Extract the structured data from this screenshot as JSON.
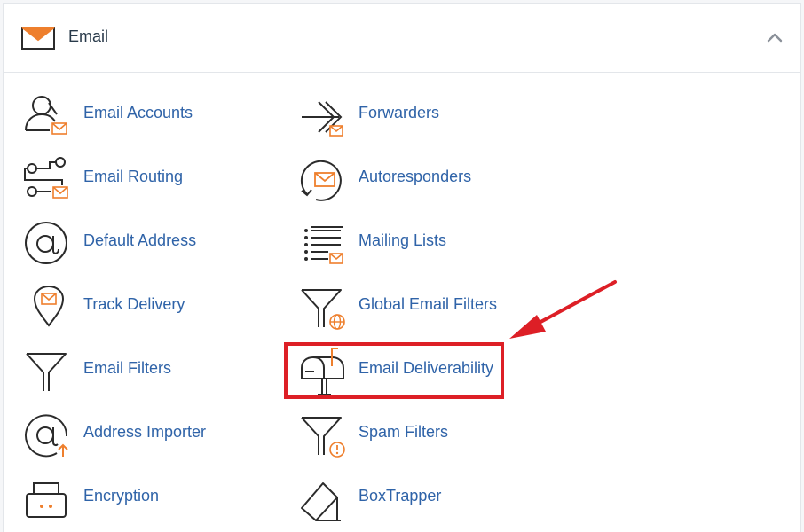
{
  "section": {
    "title": "Email",
    "collapse_icon": "chevron-up-icon"
  },
  "colors": {
    "accent_orange": "#ee7f2d",
    "link_blue": "#2f63a8",
    "icon_dark": "#2b2b2b",
    "highlight_red": "#dd1f26"
  },
  "left_column": [
    {
      "label": "Email Accounts",
      "icon": "email-accounts-icon"
    },
    {
      "label": "Email Routing",
      "icon": "email-routing-icon"
    },
    {
      "label": "Default Address",
      "icon": "at-sign-icon"
    },
    {
      "label": "Track Delivery",
      "icon": "location-pin-mail-icon"
    },
    {
      "label": "Email Filters",
      "icon": "funnel-icon"
    },
    {
      "label": "Address Importer",
      "icon": "at-sign-upload-icon"
    },
    {
      "label": "Encryption",
      "icon": "encryption-icon"
    }
  ],
  "right_column": [
    {
      "label": "Forwarders",
      "icon": "forward-arrows-icon"
    },
    {
      "label": "Autoresponders",
      "icon": "autoresponder-icon"
    },
    {
      "label": "Mailing Lists",
      "icon": "list-mail-icon"
    },
    {
      "label": "Global Email Filters",
      "icon": "funnel-globe-icon"
    },
    {
      "label": "Email Deliverability",
      "icon": "mailbox-icon"
    },
    {
      "label": "Spam Filters",
      "icon": "funnel-warning-icon"
    },
    {
      "label": "BoxTrapper",
      "icon": "boxtrapper-icon"
    }
  ]
}
